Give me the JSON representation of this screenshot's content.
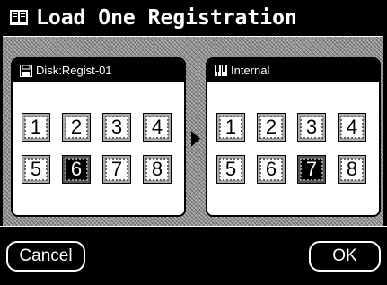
{
  "window": {
    "title": "Load One Registration",
    "title_icon": "book-icon"
  },
  "source_panel": {
    "label": "Disk:Regist-01",
    "icon": "disk-icon",
    "slots": [
      "1",
      "2",
      "3",
      "4",
      "5",
      "6",
      "7",
      "8"
    ],
    "selected": "6"
  },
  "destination_panel": {
    "label": "Internal",
    "icon": "keyboard-icon",
    "slots": [
      "1",
      "2",
      "3",
      "4",
      "5",
      "6",
      "7",
      "8"
    ],
    "selected": "7"
  },
  "footer": {
    "cancel_label": "Cancel",
    "ok_label": "OK"
  }
}
